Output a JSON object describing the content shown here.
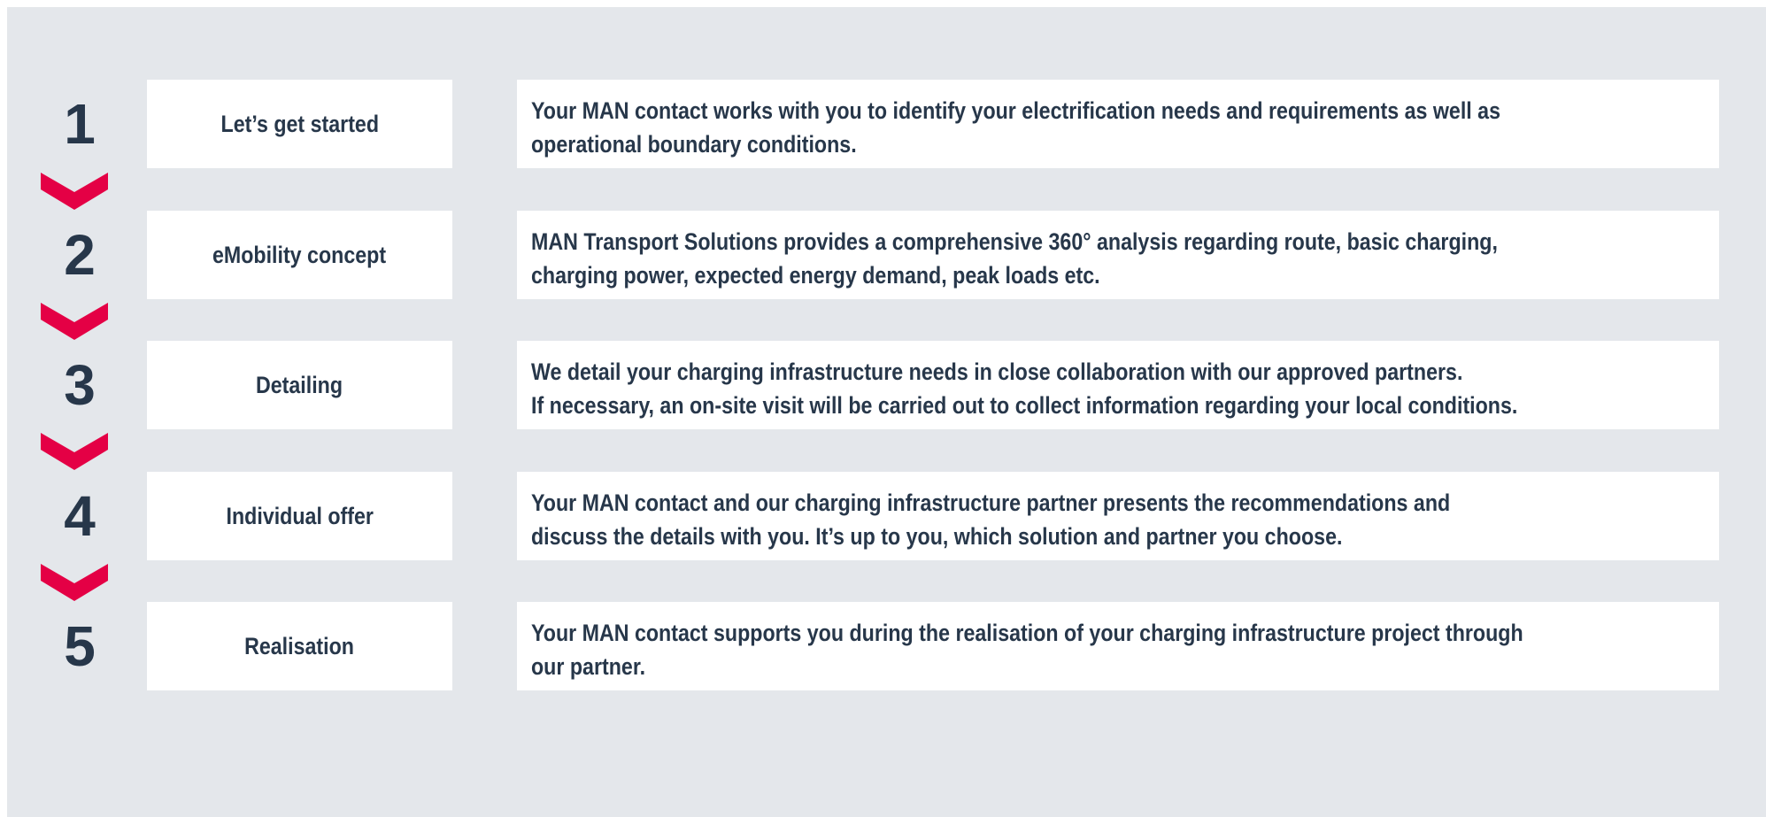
{
  "steps": [
    {
      "number": "1",
      "title": "Let’s get started",
      "description": "Your MAN contact works with you to identify your electrification needs and requirements as well as\noperational boundary conditions."
    },
    {
      "number": "2",
      "title": "eMobility concept",
      "description": "MAN Transport Solutions provides a comprehensive 360° analysis regarding route, basic charging,\ncharging power, expected energy demand, peak loads etc."
    },
    {
      "number": "3",
      "title": "Detailing",
      "description": "We detail your charging infrastructure needs in close collaboration with our approved partners.\nIf necessary, an on-site visit will be carried out to collect information regarding your local conditions."
    },
    {
      "number": "4",
      "title": "Individual offer",
      "description": "Your MAN contact and our charging infrastructure partner presents the recommendations and\ndiscuss the details with you. It’s up to you, which solution and partner you choose."
    },
    {
      "number": "5",
      "title": "Realisation",
      "description": "Your MAN contact supports you during the realisation of your charging infrastructure project through\nour partner."
    }
  ],
  "colors": {
    "background": "#e4e7eb",
    "text": "#27374a",
    "chevron": "#e40045",
    "box": "#ffffff"
  }
}
